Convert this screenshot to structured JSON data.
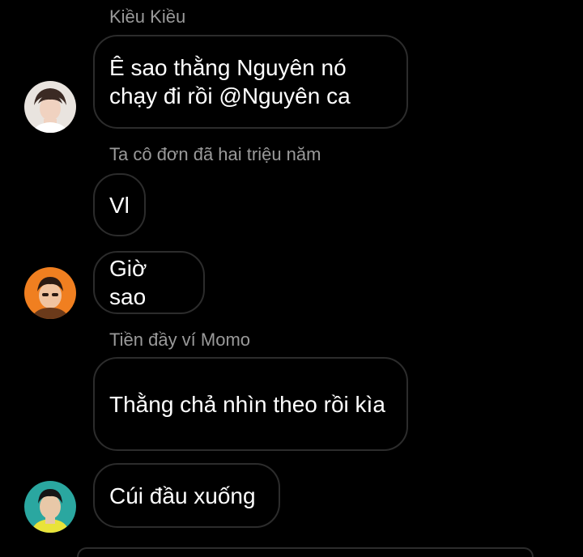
{
  "messages": [
    {
      "sender": "Kiều Kiều",
      "text": "Ê sao thằng Nguyên nó chạy đi rồi @Nguyên ca"
    },
    {
      "sender": "Ta cô đơn đã hai triệu năm",
      "text": "Vl"
    },
    {
      "sender": "",
      "text": "Giờ sao"
    },
    {
      "sender": "Tiền đầy ví Momo",
      "text": "Thằng chả nhìn theo rồi kìa"
    },
    {
      "sender": "",
      "text": "Cúi đầu xuống"
    }
  ],
  "avatars": [
    {
      "name": "avatar-kieu-kieu",
      "colors": [
        "#e9e4df",
        "#3b2a24",
        "#f0d2c0"
      ]
    },
    {
      "name": "avatar-ta-co-don",
      "colors": [
        "#f07f20",
        "#2b1a12",
        "#f1c4a0"
      ]
    },
    {
      "name": "avatar-tien-day-vi",
      "colors": [
        "#2aa7a0",
        "#151515",
        "#e8c8a8"
      ]
    }
  ],
  "theme": {
    "background": "#000000",
    "bubble_border": "#2c2c2c",
    "sender_color": "#9a9a9a",
    "text_color": "#ffffff"
  }
}
